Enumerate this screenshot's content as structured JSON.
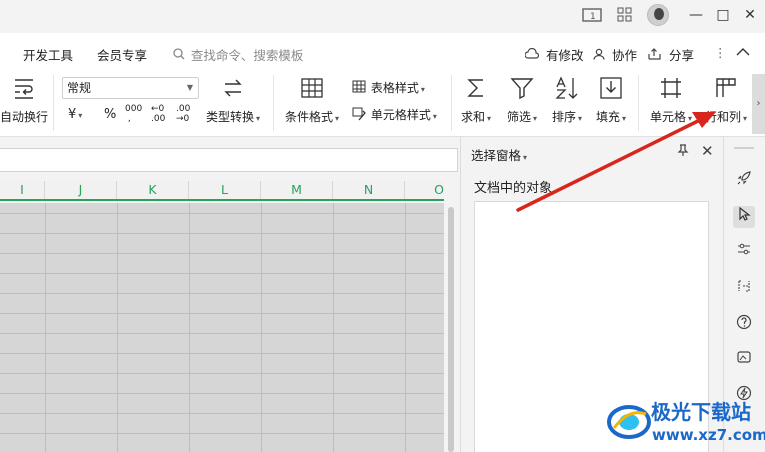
{
  "titlebar": {
    "window_buttons": {
      "minimize": "—",
      "maximize": "□",
      "close": "✕"
    }
  },
  "menu": {
    "tabs": [
      "开发工具",
      "会员专享"
    ],
    "search_placeholder": "查找命令、搜索模板",
    "right_actions": {
      "modified": "有修改",
      "collab": "协作",
      "share": "分享"
    }
  },
  "ribbon": {
    "wrap_label": "自动换行",
    "number_format": "常规",
    "currency": "¥",
    "percent": "%",
    "thousands": "000",
    "dec_increase": "←0 .00",
    "dec_decrease": ".00 →0",
    "type_convert": "类型转换",
    "conditional_format": "条件格式",
    "table_style": "表格样式",
    "cell_style": "单元格样式",
    "sum": "求和",
    "filter": "筛选",
    "sort": "排序",
    "fill": "填充",
    "cell": "单元格",
    "row_col": "行和列"
  },
  "sheet": {
    "columns": [
      "I",
      "J",
      "K",
      "L",
      "M",
      "N",
      "O"
    ]
  },
  "selection_pane": {
    "title": "选择窗格",
    "objects_label": "文档中的对象"
  },
  "accent_colors": {
    "grid_header_green": "#27a35d",
    "arrow_red": "#d9261c",
    "watermark_blue": "#1c68c9"
  },
  "watermark": {
    "site_name": "极光下载站",
    "url": "www.xz7.com"
  }
}
